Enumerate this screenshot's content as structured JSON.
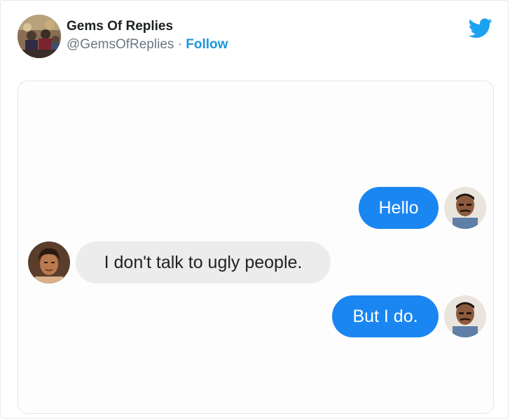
{
  "tweet": {
    "author_name": "Gems Of Replies",
    "author_handle": "@GemsOfReplies",
    "separator": "·",
    "follow_label": "Follow"
  },
  "icons": {
    "brand": "twitter-bird-icon"
  },
  "colors": {
    "link": "#1b95e0",
    "twitter_blue": "#1da1f2",
    "sent_bubble": "#1a86f2",
    "received_bubble": "#ececec"
  },
  "chat": {
    "messages": [
      {
        "sender": "outgoing",
        "text": "Hello"
      },
      {
        "sender": "incoming",
        "text": "I don't talk to ugly people."
      },
      {
        "sender": "outgoing",
        "text": "But I do."
      }
    ]
  }
}
